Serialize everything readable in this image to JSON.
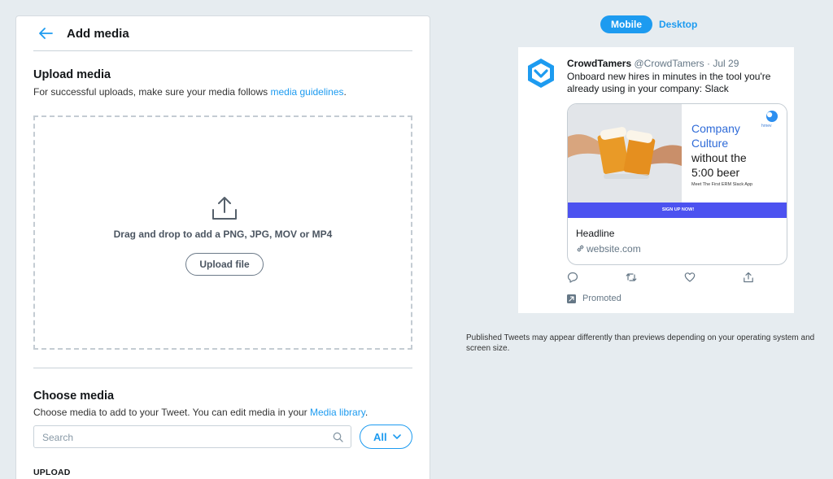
{
  "header": {
    "title": "Add media"
  },
  "upload": {
    "title": "Upload media",
    "desc_prefix": "For successful uploads, make sure your media follows ",
    "desc_link": "media guidelines",
    "desc_suffix": ".",
    "drop_text": "Drag and drop to add a PNG, JPG, MOV or MP4",
    "button_label": "Upload file"
  },
  "choose": {
    "title": "Choose media",
    "desc_prefix": "Choose media to add to your Tweet. You can edit media in your ",
    "desc_link": "Media library",
    "desc_suffix": ".",
    "search_placeholder": "Search",
    "filter_label": "All",
    "upload_section_label": "UPLOAD"
  },
  "preview": {
    "tabs": {
      "mobile": "Mobile",
      "desktop": "Desktop",
      "active": "mobile"
    },
    "tweet": {
      "name": "CrowdTamers",
      "handle": "@CrowdTamers",
      "dot": " · ",
      "date": "Jul 29",
      "text": "Onboard new hires in minutes in the tool you're already using in your company: Slack",
      "card": {
        "img_line1": "Company",
        "img_line2": "Culture",
        "img_line3": "without the",
        "img_line4": "5:00 beer",
        "img_sub": "Meet The First ERM Slack App",
        "img_logo_text": "hrnev",
        "img_cta": "SIGN UP NOW!",
        "headline": "Headline",
        "url": "website.com"
      },
      "promoted": "Promoted"
    },
    "disclaimer_line1": "Published Tweets may appear differently than previews depending on your operating system and",
    "disclaimer_line2": "screen size."
  },
  "colors": {
    "accent": "#1d9bf0",
    "background": "#e6ecf0",
    "cta_bar": "#4c52f0"
  },
  "icons": [
    "back-arrow-icon",
    "upload-icon",
    "search-icon",
    "chevron-down-icon",
    "reply-icon",
    "retweet-icon",
    "like-icon",
    "share-icon",
    "promoted-icon",
    "link-icon"
  ]
}
